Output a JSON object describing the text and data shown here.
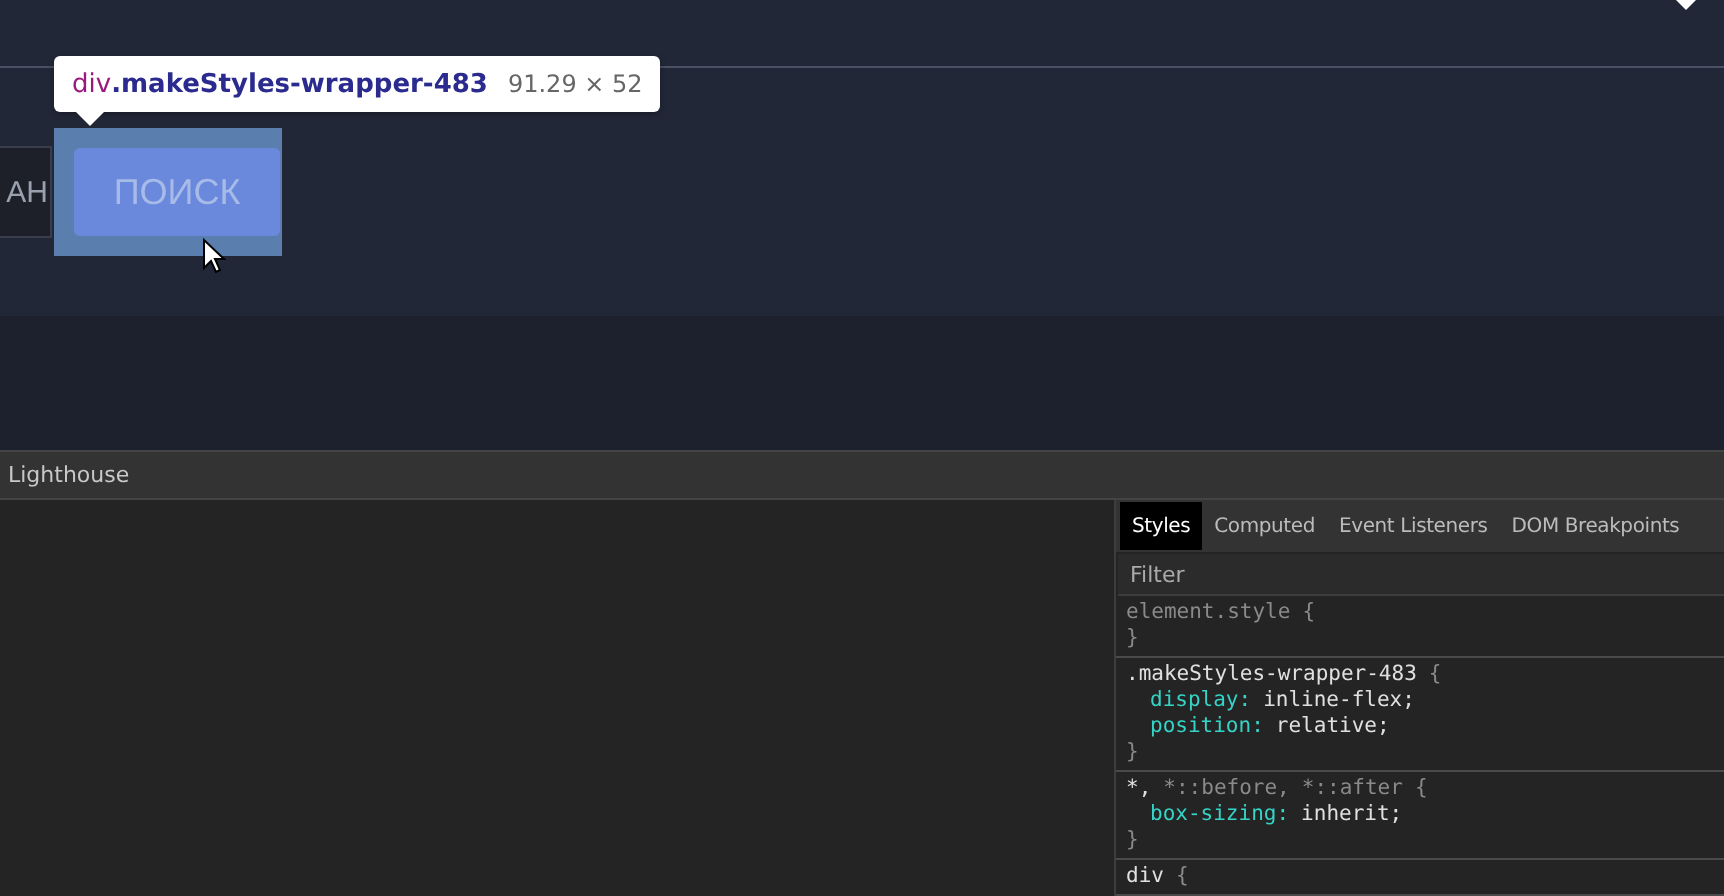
{
  "page": {
    "left_button": "АН",
    "search_button": "ПОИСК"
  },
  "inspect_tooltip": {
    "tag": "div",
    "class_name": ".makeStyles-wrapper-483",
    "size": "91.29 × 52"
  },
  "devtools": {
    "panel_tab": "Lighthouse",
    "styles_tabs": [
      {
        "label": "Styles",
        "selected": true
      },
      {
        "label": "Computed",
        "selected": false
      },
      {
        "label": "Event Listeners",
        "selected": false
      },
      {
        "label": "DOM Breakpoints",
        "selected": false
      }
    ],
    "filter": {
      "placeholder": "Filter"
    },
    "rules": [
      {
        "selectors": [
          {
            "text": "element.style",
            "matched": false
          }
        ],
        "open": "{",
        "close": "}"
      },
      {
        "selectors": [
          {
            "text": ".makeStyles-wrapper-483",
            "matched": true
          }
        ],
        "open": "{",
        "close": "}",
        "properties": [
          {
            "name": "display:",
            "value": "inline-flex;"
          },
          {
            "name": "position:",
            "value": "relative;"
          }
        ]
      },
      {
        "selectors": [
          {
            "text": "*,",
            "matched": true
          },
          {
            "text": "*::before,",
            "matched": false
          },
          {
            "text": "*::after",
            "matched": false
          }
        ],
        "open": "{",
        "close": "}",
        "properties": [
          {
            "name": "box-sizing:",
            "value": "inherit;"
          }
        ]
      },
      {
        "selectors": [
          {
            "text": "div",
            "matched": true
          }
        ],
        "open": "{"
      }
    ]
  }
}
